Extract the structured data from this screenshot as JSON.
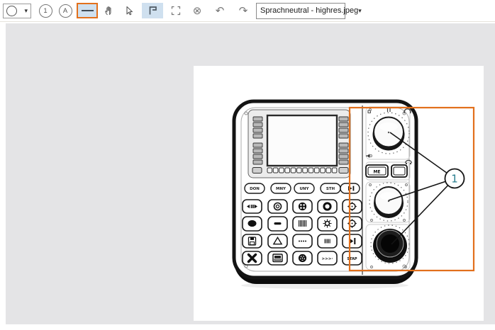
{
  "toolbar": {
    "number_tool_label": "1",
    "text_tool_label": "A",
    "file_selector_value": "Sprachneutral - highres.jpeg"
  },
  "icons": {
    "caret_down": "▾",
    "undo": "↶",
    "redo": "↷",
    "close": "⊗"
  },
  "annotation": {
    "callout_label": "1",
    "rectangle_color": "#e2701c",
    "callout_label_color": "#2a7f8f"
  },
  "device": {
    "mode_buttons": [
      "DON",
      "MNY",
      "UNY",
      "STH"
    ],
    "me_button_label": "ME",
    "skip_button_label": ">>>·",
    "stop_button_label": "STAP"
  },
  "colors": {
    "annotation_orange": "#e2701c",
    "callout_teal": "#2a7f8f",
    "selected_tool_bg": "#cfe0ef",
    "selected_tool_border": "#e2701c",
    "canvas_gray": "#e4e4e6"
  }
}
